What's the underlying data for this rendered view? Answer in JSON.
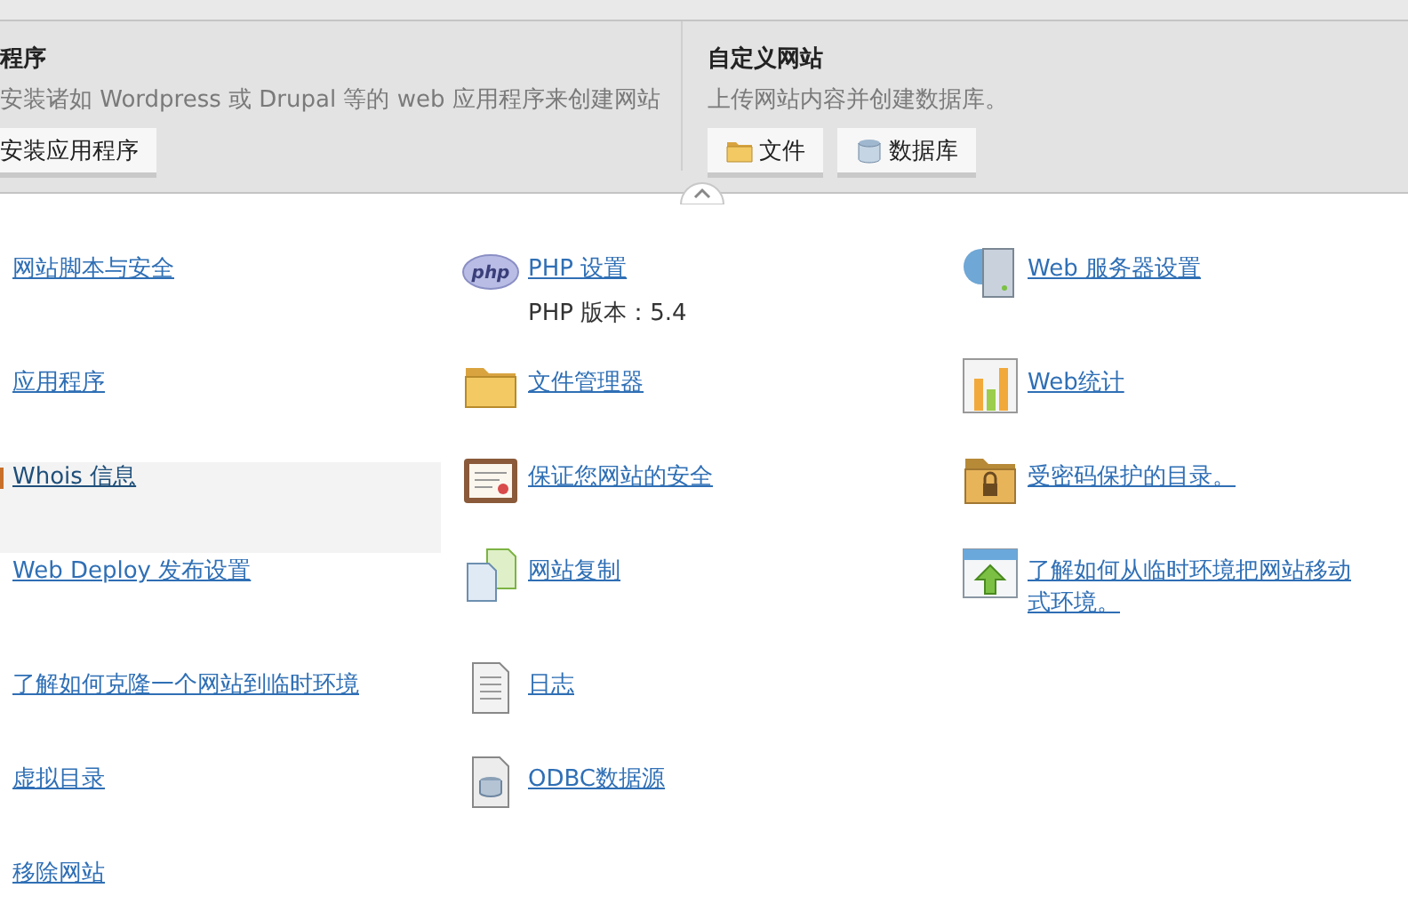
{
  "sections": [
    {
      "title": "程序",
      "description": "安装诸如 Wordpress 或 Drupal 等的 web 应用程序来创建网站",
      "buttons": [
        {
          "label": "安装应用程序",
          "kind": "plain"
        }
      ]
    },
    {
      "title": "自定义网站",
      "description": "上传网站内容并创建数据库。",
      "buttons": [
        {
          "label": "文件",
          "kind": "folder"
        },
        {
          "label": "数据库",
          "kind": "database"
        }
      ]
    }
  ],
  "rows": [
    {
      "cells": [
        {
          "lines": [
            "网站脚本与安全"
          ],
          "kind": "plain",
          "selected": false
        },
        {
          "lines": [
            "PHP 设置"
          ],
          "detail": "PHP 版本：5.4",
          "kind": "php",
          "selected": false
        },
        {
          "lines": [
            "Web 服务器设置"
          ],
          "kind": "server",
          "selected": false
        }
      ]
    },
    {
      "cells": [
        {
          "lines": [
            "应用程序"
          ],
          "kind": "plain",
          "selected": false
        },
        {
          "lines": [
            "文件管理器"
          ],
          "kind": "folder",
          "selected": false
        },
        {
          "lines": [
            "Web统计"
          ],
          "kind": "chart",
          "selected": false
        }
      ]
    },
    {
      "cells": [
        {
          "lines": [
            "Whois 信息"
          ],
          "kind": "plain",
          "selected": true
        },
        {
          "lines": [
            "保证您网站的安全"
          ],
          "kind": "certificate",
          "selected": false
        },
        {
          "lines": [
            "受密码保护的目录。"
          ],
          "kind": "lockfolder",
          "selected": false
        }
      ]
    },
    {
      "cells": [
        {
          "lines": [
            "Web Deploy 发布设置"
          ],
          "kind": "plain",
          "selected": false
        },
        {
          "lines": [
            "网站复制"
          ],
          "kind": "copy",
          "selected": false
        },
        {
          "lines": [
            "了解如何从临时环境把网站移动",
            "式环境。"
          ],
          "kind": "upload",
          "selected": false
        }
      ]
    },
    {
      "cells": [
        {
          "lines": [
            "了解如何克隆一个网站到临时环境"
          ],
          "kind": "plain",
          "selected": false
        },
        {
          "lines": [
            "日志"
          ],
          "kind": "log",
          "selected": false
        }
      ]
    },
    {
      "cells": [
        {
          "lines": [
            "虚拟目录"
          ],
          "kind": "plain",
          "selected": false
        },
        {
          "lines": [
            "ODBC数据源"
          ],
          "kind": "dbfile",
          "selected": false
        }
      ]
    },
    {
      "cells": [
        {
          "lines": [
            "移除网站"
          ],
          "kind": "plain",
          "selected": false
        }
      ]
    }
  ]
}
